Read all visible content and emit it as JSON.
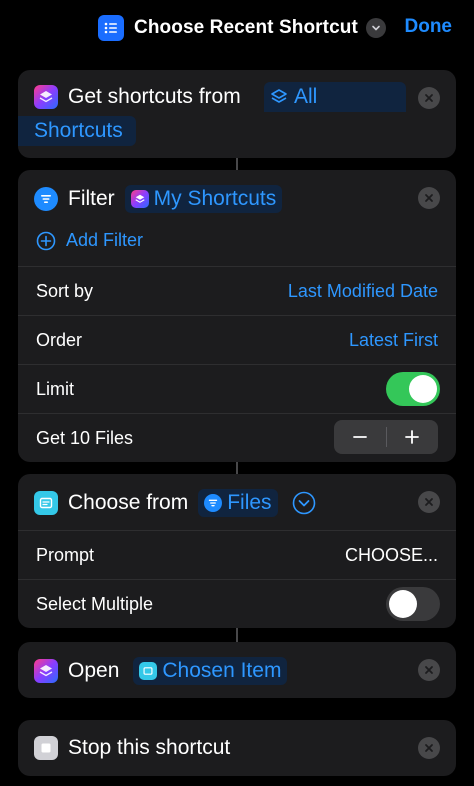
{
  "header": {
    "title": "Choose Recent Shortcut",
    "done_label": "Done"
  },
  "actions": {
    "get_shortcuts": {
      "label": "Get shortcuts from",
      "token_line1": "All",
      "token_line2": "Shortcuts"
    },
    "filter": {
      "label": "Filter",
      "token": "My Shortcuts",
      "add_filter": "Add Filter",
      "sort_by_label": "Sort by",
      "sort_by_value": "Last Modified Date",
      "order_label": "Order",
      "order_value": "Latest First",
      "limit_label": "Limit",
      "limit_on": true,
      "get_count_label": "Get 10 Files"
    },
    "choose_from": {
      "label": "Choose from",
      "token": "Files",
      "prompt_label": "Prompt",
      "prompt_value": "CHOOSE...",
      "select_multiple_label": "Select Multiple",
      "select_multiple_on": false
    },
    "open": {
      "label": "Open",
      "token": "Chosen Item"
    },
    "stop": {
      "label": "Stop this shortcut"
    }
  },
  "colors": {
    "accent": "#1e8bff",
    "toggle_on": "#34c759",
    "card_bg": "#1c1c1e"
  }
}
